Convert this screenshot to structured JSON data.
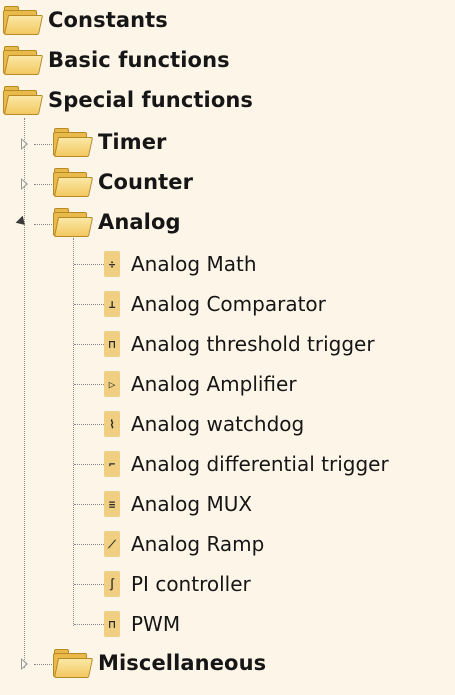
{
  "tree": {
    "constants": "Constants",
    "basic_functions": "Basic functions",
    "special_functions": "Special functions",
    "timer": "Timer",
    "counter": "Counter",
    "analog": "Analog",
    "analog_items": [
      {
        "label": "Analog Math",
        "icon": "analog-math-icon"
      },
      {
        "label": "Analog Comparator",
        "icon": "analog-comparator-icon"
      },
      {
        "label": "Analog threshold trigger",
        "icon": "analog-threshold-trigger-icon"
      },
      {
        "label": "Analog Amplifier",
        "icon": "analog-amplifier-icon"
      },
      {
        "label": "Analog watchdog",
        "icon": "analog-watchdog-icon"
      },
      {
        "label": "Analog differential trigger",
        "icon": "analog-differential-trigger-icon"
      },
      {
        "label": "Analog MUX",
        "icon": "analog-mux-icon"
      },
      {
        "label": "Analog Ramp",
        "icon": "analog-ramp-icon"
      },
      {
        "label": "PI controller",
        "icon": "pi-controller-icon"
      },
      {
        "label": "PWM",
        "icon": "pwm-icon"
      }
    ],
    "miscellaneous": "Miscellaneous"
  },
  "colors": {
    "background": "#fdf6e8",
    "folder": "#e9b94a",
    "block_icon": "#f0cf82"
  }
}
